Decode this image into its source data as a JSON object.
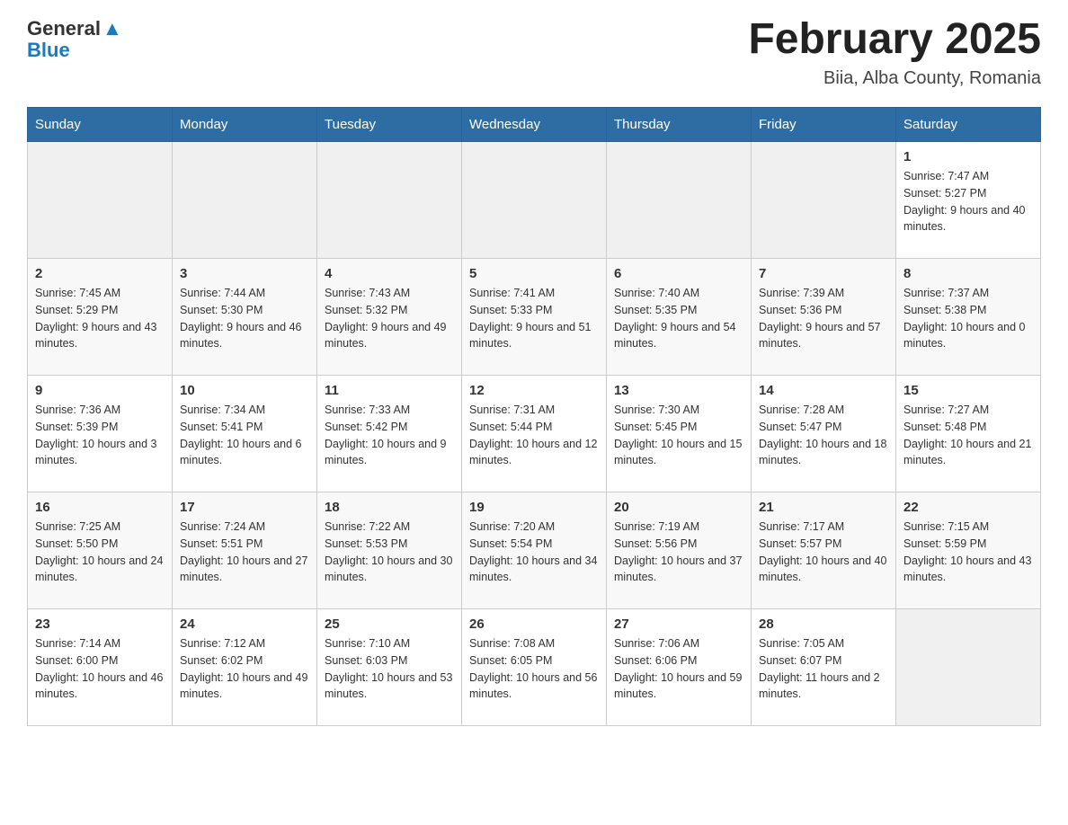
{
  "header": {
    "logo": {
      "line1": "General",
      "line2": "Blue",
      "arrow": "▼"
    },
    "title": "February 2025",
    "location": "Biia, Alba County, Romania"
  },
  "weekdays": [
    "Sunday",
    "Monday",
    "Tuesday",
    "Wednesday",
    "Thursday",
    "Friday",
    "Saturday"
  ],
  "weeks": [
    [
      {
        "day": "",
        "sunrise": "",
        "sunset": "",
        "daylight": ""
      },
      {
        "day": "",
        "sunrise": "",
        "sunset": "",
        "daylight": ""
      },
      {
        "day": "",
        "sunrise": "",
        "sunset": "",
        "daylight": ""
      },
      {
        "day": "",
        "sunrise": "",
        "sunset": "",
        "daylight": ""
      },
      {
        "day": "",
        "sunrise": "",
        "sunset": "",
        "daylight": ""
      },
      {
        "day": "",
        "sunrise": "",
        "sunset": "",
        "daylight": ""
      },
      {
        "day": "1",
        "sunrise": "Sunrise: 7:47 AM",
        "sunset": "Sunset: 5:27 PM",
        "daylight": "Daylight: 9 hours and 40 minutes."
      }
    ],
    [
      {
        "day": "2",
        "sunrise": "Sunrise: 7:45 AM",
        "sunset": "Sunset: 5:29 PM",
        "daylight": "Daylight: 9 hours and 43 minutes."
      },
      {
        "day": "3",
        "sunrise": "Sunrise: 7:44 AM",
        "sunset": "Sunset: 5:30 PM",
        "daylight": "Daylight: 9 hours and 46 minutes."
      },
      {
        "day": "4",
        "sunrise": "Sunrise: 7:43 AM",
        "sunset": "Sunset: 5:32 PM",
        "daylight": "Daylight: 9 hours and 49 minutes."
      },
      {
        "day": "5",
        "sunrise": "Sunrise: 7:41 AM",
        "sunset": "Sunset: 5:33 PM",
        "daylight": "Daylight: 9 hours and 51 minutes."
      },
      {
        "day": "6",
        "sunrise": "Sunrise: 7:40 AM",
        "sunset": "Sunset: 5:35 PM",
        "daylight": "Daylight: 9 hours and 54 minutes."
      },
      {
        "day": "7",
        "sunrise": "Sunrise: 7:39 AM",
        "sunset": "Sunset: 5:36 PM",
        "daylight": "Daylight: 9 hours and 57 minutes."
      },
      {
        "day": "8",
        "sunrise": "Sunrise: 7:37 AM",
        "sunset": "Sunset: 5:38 PM",
        "daylight": "Daylight: 10 hours and 0 minutes."
      }
    ],
    [
      {
        "day": "9",
        "sunrise": "Sunrise: 7:36 AM",
        "sunset": "Sunset: 5:39 PM",
        "daylight": "Daylight: 10 hours and 3 minutes."
      },
      {
        "day": "10",
        "sunrise": "Sunrise: 7:34 AM",
        "sunset": "Sunset: 5:41 PM",
        "daylight": "Daylight: 10 hours and 6 minutes."
      },
      {
        "day": "11",
        "sunrise": "Sunrise: 7:33 AM",
        "sunset": "Sunset: 5:42 PM",
        "daylight": "Daylight: 10 hours and 9 minutes."
      },
      {
        "day": "12",
        "sunrise": "Sunrise: 7:31 AM",
        "sunset": "Sunset: 5:44 PM",
        "daylight": "Daylight: 10 hours and 12 minutes."
      },
      {
        "day": "13",
        "sunrise": "Sunrise: 7:30 AM",
        "sunset": "Sunset: 5:45 PM",
        "daylight": "Daylight: 10 hours and 15 minutes."
      },
      {
        "day": "14",
        "sunrise": "Sunrise: 7:28 AM",
        "sunset": "Sunset: 5:47 PM",
        "daylight": "Daylight: 10 hours and 18 minutes."
      },
      {
        "day": "15",
        "sunrise": "Sunrise: 7:27 AM",
        "sunset": "Sunset: 5:48 PM",
        "daylight": "Daylight: 10 hours and 21 minutes."
      }
    ],
    [
      {
        "day": "16",
        "sunrise": "Sunrise: 7:25 AM",
        "sunset": "Sunset: 5:50 PM",
        "daylight": "Daylight: 10 hours and 24 minutes."
      },
      {
        "day": "17",
        "sunrise": "Sunrise: 7:24 AM",
        "sunset": "Sunset: 5:51 PM",
        "daylight": "Daylight: 10 hours and 27 minutes."
      },
      {
        "day": "18",
        "sunrise": "Sunrise: 7:22 AM",
        "sunset": "Sunset: 5:53 PM",
        "daylight": "Daylight: 10 hours and 30 minutes."
      },
      {
        "day": "19",
        "sunrise": "Sunrise: 7:20 AM",
        "sunset": "Sunset: 5:54 PM",
        "daylight": "Daylight: 10 hours and 34 minutes."
      },
      {
        "day": "20",
        "sunrise": "Sunrise: 7:19 AM",
        "sunset": "Sunset: 5:56 PM",
        "daylight": "Daylight: 10 hours and 37 minutes."
      },
      {
        "day": "21",
        "sunrise": "Sunrise: 7:17 AM",
        "sunset": "Sunset: 5:57 PM",
        "daylight": "Daylight: 10 hours and 40 minutes."
      },
      {
        "day": "22",
        "sunrise": "Sunrise: 7:15 AM",
        "sunset": "Sunset: 5:59 PM",
        "daylight": "Daylight: 10 hours and 43 minutes."
      }
    ],
    [
      {
        "day": "23",
        "sunrise": "Sunrise: 7:14 AM",
        "sunset": "Sunset: 6:00 PM",
        "daylight": "Daylight: 10 hours and 46 minutes."
      },
      {
        "day": "24",
        "sunrise": "Sunrise: 7:12 AM",
        "sunset": "Sunset: 6:02 PM",
        "daylight": "Daylight: 10 hours and 49 minutes."
      },
      {
        "day": "25",
        "sunrise": "Sunrise: 7:10 AM",
        "sunset": "Sunset: 6:03 PM",
        "daylight": "Daylight: 10 hours and 53 minutes."
      },
      {
        "day": "26",
        "sunrise": "Sunrise: 7:08 AM",
        "sunset": "Sunset: 6:05 PM",
        "daylight": "Daylight: 10 hours and 56 minutes."
      },
      {
        "day": "27",
        "sunrise": "Sunrise: 7:06 AM",
        "sunset": "Sunset: 6:06 PM",
        "daylight": "Daylight: 10 hours and 59 minutes."
      },
      {
        "day": "28",
        "sunrise": "Sunrise: 7:05 AM",
        "sunset": "Sunset: 6:07 PM",
        "daylight": "Daylight: 11 hours and 2 minutes."
      },
      {
        "day": "",
        "sunrise": "",
        "sunset": "",
        "daylight": ""
      }
    ]
  ]
}
